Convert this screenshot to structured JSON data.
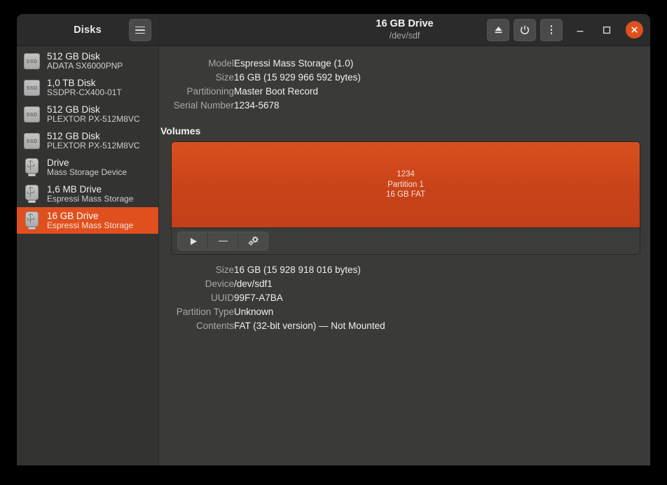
{
  "window": {
    "titlebar": {
      "sidebar_title": "Disks",
      "title": "16 GB Drive",
      "subtitle": "/dev/sdf",
      "menu_button": "hamburger-menu",
      "eject_button": "eject",
      "power_button": "power-off",
      "more_button": "more-options",
      "minimize": "minimize",
      "maximize": "maximize",
      "close": "close"
    }
  },
  "sidebar": {
    "items": [
      {
        "name": "512 GB Disk",
        "sub": "ADATA SX6000PNP",
        "icon": "ssd-icon",
        "icon_label": "SSD",
        "selected": false
      },
      {
        "name": "1,0 TB Disk",
        "sub": "SSDPR-CX400-01T",
        "icon": "ssd-icon",
        "icon_label": "SSD",
        "selected": false
      },
      {
        "name": "512 GB Disk",
        "sub": "PLEXTOR PX-512M8VC",
        "icon": "ssd-icon",
        "icon_label": "SSD",
        "selected": false
      },
      {
        "name": "512 GB Disk",
        "sub": "PLEXTOR PX-512M8VC",
        "icon": "ssd-icon",
        "icon_label": "SSD",
        "selected": false
      },
      {
        "name": "Drive",
        "sub": "Mass Storage Device",
        "icon": "usb-icon",
        "icon_label": "",
        "selected": false
      },
      {
        "name": "1,6 MB Drive",
        "sub": "Espressi Mass Storage",
        "icon": "usb-icon",
        "icon_label": "",
        "selected": false
      },
      {
        "name": "16 GB Drive",
        "sub": "Espressi Mass Storage",
        "icon": "usb-icon",
        "icon_label": "",
        "selected": true
      }
    ]
  },
  "drive_properties": [
    {
      "label": "Model",
      "value": "Espressi Mass Storage (1.0)"
    },
    {
      "label": "Size",
      "value": "16 GB (15 929 966 592 bytes)"
    },
    {
      "label": "Partitioning",
      "value": "Master Boot Record"
    },
    {
      "label": "Serial Number",
      "value": "1234-5678"
    }
  ],
  "volumes": {
    "heading": "Volumes",
    "selected_volume": {
      "label": "1234",
      "partition": "Partition 1",
      "size_type": "16 GB FAT"
    },
    "toolbar": {
      "mount_button": "mount",
      "unmount_button": "unmount",
      "settings_button": "additional-partition-options"
    }
  },
  "volume_properties": [
    {
      "label": "Size",
      "value": "16 GB (15 928 918 016 bytes)"
    },
    {
      "label": "Device",
      "value": "/dev/sdf1"
    },
    {
      "label": "UUID",
      "value": "99F7-A7BA"
    },
    {
      "label": "Partition Type",
      "value": "Unknown"
    },
    {
      "label": "Contents",
      "value": "FAT (32-bit version) — Not Mounted"
    }
  ],
  "colors": {
    "accent": "#e0501e",
    "volume_fill": "#c9431a",
    "window_bg": "#3a3a38",
    "sidebar_bg": "#333331",
    "headerbar_bg": "#2b2b2b"
  }
}
